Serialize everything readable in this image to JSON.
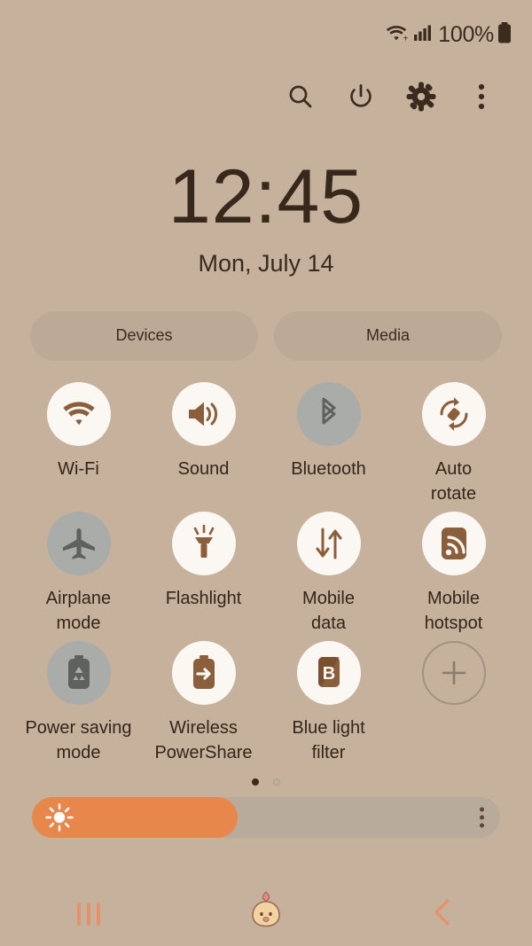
{
  "status_bar": {
    "wifi_icon": "wifi-icon",
    "signal_icon": "cellular-signal-icon",
    "battery_percent": "100%",
    "battery_icon": "battery-full-icon"
  },
  "header": {
    "icons": [
      {
        "name": "search-icon",
        "label": "Search"
      },
      {
        "name": "power-icon",
        "label": "Power"
      },
      {
        "name": "gear-icon",
        "label": "Settings"
      },
      {
        "name": "more-vertical-icon",
        "label": "More options"
      }
    ]
  },
  "clock": {
    "time": "12:45",
    "date": "Mon, July 14"
  },
  "pills": [
    {
      "label": "Devices"
    },
    {
      "label": "Media"
    }
  ],
  "quick_settings": {
    "tiles": [
      {
        "label": "Wi-Fi",
        "icon": "wifi-icon",
        "state": "on"
      },
      {
        "label": "Sound",
        "icon": "sound-icon",
        "state": "on"
      },
      {
        "label": "Bluetooth",
        "icon": "bluetooth-icon",
        "state": "off"
      },
      {
        "label": "Auto\nrotate",
        "icon": "auto-rotate-icon",
        "state": "on"
      },
      {
        "label": "Airplane\nmode",
        "icon": "airplane-icon",
        "state": "off"
      },
      {
        "label": "Flashlight",
        "icon": "flashlight-icon",
        "state": "on"
      },
      {
        "label": "Mobile\ndata",
        "icon": "mobile-data-icon",
        "state": "on"
      },
      {
        "label": "Mobile\nhotspot",
        "icon": "mobile-hotspot-icon",
        "state": "on"
      },
      {
        "label": "Power saving\nmode",
        "icon": "power-saving-icon",
        "state": "off"
      },
      {
        "label": "Wireless\nPowerShare",
        "icon": "power-share-icon",
        "state": "on"
      },
      {
        "label": "Blue light\nfilter",
        "icon": "blue-light-icon",
        "state": "on"
      },
      {
        "label": "",
        "icon": "plus-icon",
        "state": "add"
      }
    ]
  },
  "page_indicator": {
    "total": 2,
    "current": 1
  },
  "brightness": {
    "icon": "brightness-sun-icon",
    "value_percent": 44,
    "menu_icon": "more-vertical-icon"
  },
  "nav_bar": {
    "recents": {
      "name": "recents-button"
    },
    "home": {
      "name": "home-button-chick"
    },
    "back": {
      "name": "back-button"
    }
  },
  "colors": {
    "background": "#C6B29C",
    "tile_on": "#FBF7F2",
    "tile_off": "#A9ACA9",
    "icon_brown": "#8B5E3C",
    "icon_gray": "#5E615E",
    "accent_orange": "#E8874C",
    "nav_accent": "#E8906A",
    "text": "#3A2A1E"
  }
}
